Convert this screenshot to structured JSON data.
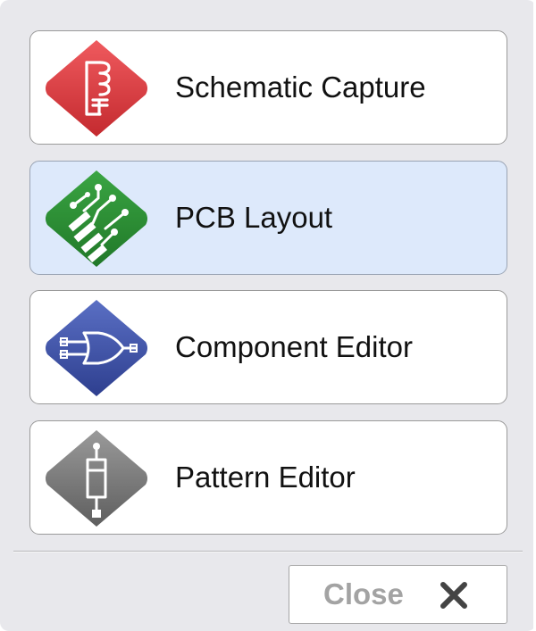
{
  "menu": {
    "items": [
      {
        "label": "Schematic Capture",
        "icon": "schematic-icon",
        "color": "#d93b3f",
        "selected": false
      },
      {
        "label": "PCB Layout",
        "icon": "pcb-icon",
        "color": "#2f8a34",
        "selected": true
      },
      {
        "label": "Component Editor",
        "icon": "component-icon",
        "color": "#3d4fa4",
        "selected": false
      },
      {
        "label": "Pattern Editor",
        "icon": "pattern-icon",
        "color": "#777777",
        "selected": false
      }
    ]
  },
  "footer": {
    "close_label": "Close",
    "close_icon": "close-icon"
  },
  "colors": {
    "selected_bg": "#dde9fb",
    "panel_bg": "#e8e8ec"
  }
}
